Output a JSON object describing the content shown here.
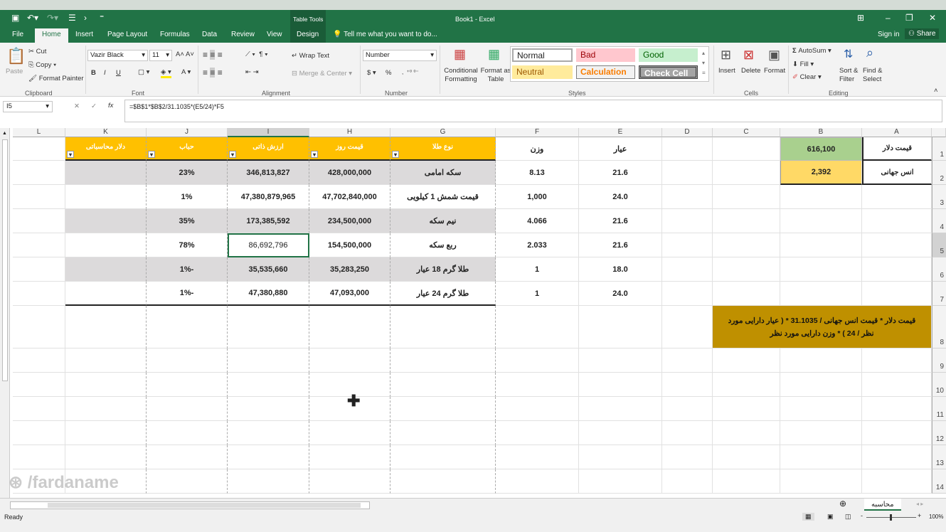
{
  "window": {
    "title": "Book1 - Excel",
    "context_group": "Table Tools",
    "sign_in": "Sign in",
    "share": "Share"
  },
  "tabs": [
    "File",
    "Home",
    "Insert",
    "Page Layout",
    "Formulas",
    "Data",
    "Review",
    "View",
    "Design"
  ],
  "tell_me": "Tell me what you want to do...",
  "ribbon": {
    "clipboard": {
      "paste": "Paste",
      "cut": "Cut",
      "copy": "Copy",
      "format_painter": "Format Painter",
      "label": "Clipboard"
    },
    "font": {
      "name": "Vazir Black",
      "size": "11",
      "label": "Font",
      "bold": "B",
      "italic": "I",
      "underline": "U"
    },
    "alignment": {
      "wrap": "Wrap Text",
      "merge": "Merge & Center",
      "label": "Alignment"
    },
    "number": {
      "format": "Number",
      "label": "Number",
      "currency": "$",
      "percent": "%"
    },
    "styles": {
      "conditional": "Conditional Formatting",
      "format_table": "Format as Table",
      "normal": "Normal",
      "bad": "Bad",
      "good": "Good",
      "neutral": "Neutral",
      "calculation": "Calculation",
      "check": "Check Cell",
      "label": "Styles"
    },
    "cells": {
      "insert": "Insert",
      "delete": "Delete",
      "format": "Format",
      "label": "Cells"
    },
    "editing": {
      "autosum": "AutoSum",
      "fill": "Fill",
      "clear": "Clear",
      "sort": "Sort & Filter",
      "find": "Find & Select",
      "label": "Editing"
    }
  },
  "formula_bar": {
    "name_box": "I5",
    "formula": "=$B$1*$B$2/31.1035*(E5/24)*F5"
  },
  "columns": [
    "L",
    "K",
    "J",
    "I",
    "H",
    "G",
    "F",
    "E",
    "D",
    "C",
    "B",
    "A"
  ],
  "rows": [
    "1",
    "2",
    "3",
    "4",
    "5",
    "6",
    "7",
    "8",
    "9",
    "10",
    "11",
    "12",
    "13",
    "14"
  ],
  "table": {
    "headers": {
      "K": "دلار محاسباتی",
      "J": "حباب",
      "I": "ارزش ذاتی",
      "H": "قیمت روز",
      "G": "نوع طلا"
    },
    "F_header": "وزن",
    "E_header": "عیار",
    "data": [
      {
        "G": "سکه امامی",
        "H": "428,000,000",
        "I": "346,813,827",
        "J": "23%",
        "F": "8.13",
        "E": "21.6"
      },
      {
        "G": "قیمت شمش 1 کیلویی",
        "H": "47,702,840,000",
        "I": "47,380,879,965",
        "J": "1%",
        "F": "1,000",
        "E": "24.0"
      },
      {
        "G": "نیم سکه",
        "H": "234,500,000",
        "I": "173,385,592",
        "J": "35%",
        "F": "4.066",
        "E": "21.6"
      },
      {
        "G": "ربع سکه",
        "H": "154,500,000",
        "I": "86,692,796",
        "J": "78%",
        "F": "2.033",
        "E": "21.6"
      },
      {
        "G": "طلا گرم 18 عیار",
        "H": "35,283,250",
        "I": "35,535,660",
        "J": "-1%",
        "F": "1",
        "E": "18.0"
      },
      {
        "G": "طلا گرم 24 عیار",
        "H": "47,093,000",
        "I": "47,380,880",
        "J": "-1%",
        "F": "1",
        "E": "24.0"
      }
    ]
  },
  "inputs": {
    "A1": "قیمت دلار",
    "B1": "616,100",
    "A2": "انس جهانی",
    "B2": "2,392"
  },
  "note": "قیمت دلار * قیمت انس جهانی / 31.1035 * ( عیار دارایی مورد نظر / 24 ) * وزن دارایی مورد نظر",
  "watermark": "/fardaname",
  "sheet_tab": "محاسبه",
  "status": {
    "ready": "Ready",
    "zoom": "100%"
  },
  "colors": {
    "excel_green": "#217346",
    "header_yellow": "#ffc000",
    "band_gray": "#dcdadb",
    "b1_green": "#a9d08e",
    "b2_yellow": "#ffd966",
    "note_gold": "#bf9000"
  }
}
